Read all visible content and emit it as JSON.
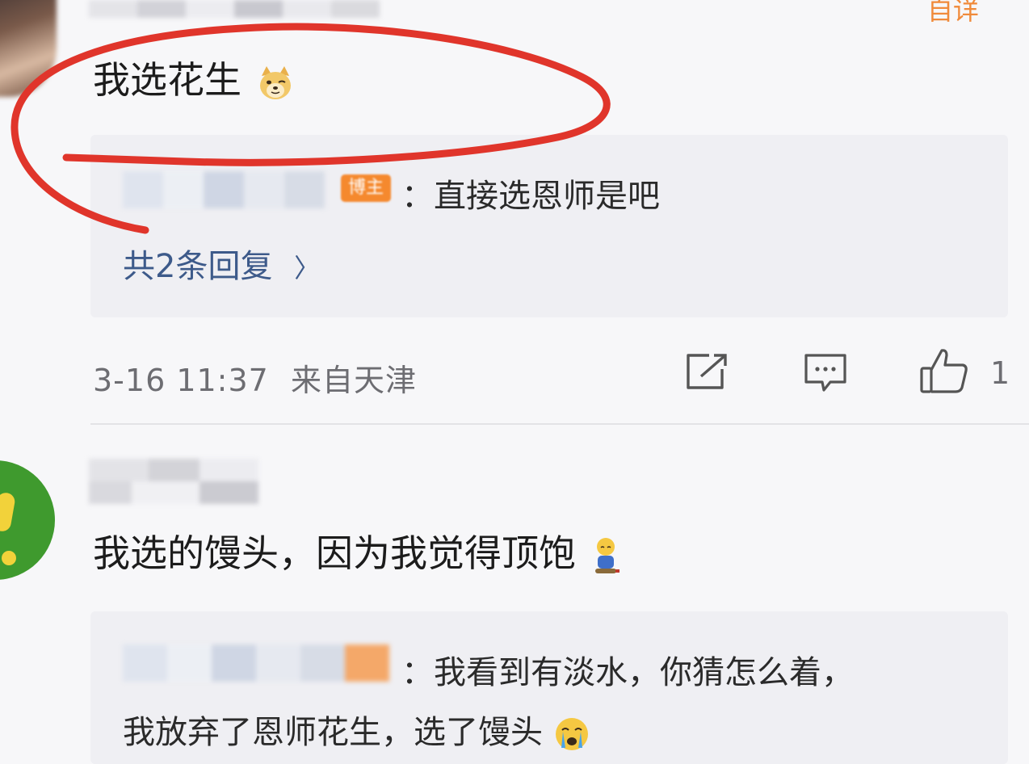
{
  "top_right_link": "自详",
  "comment1": {
    "text": "我选花生",
    "emoji": "doge-emoji",
    "reply": {
      "badge": "博主",
      "separator": "：",
      "text": "直接选恩师是吧"
    },
    "more_replies": "共2条回复",
    "more_chevron": "〉",
    "timestamp": "3-16 11:37",
    "location": "来自天津",
    "like_count": "1",
    "icons": [
      "share-icon",
      "comment-icon",
      "thumbs-up-icon"
    ]
  },
  "comment2": {
    "text": "我选的馒头，因为我觉得顶饱",
    "emoji": "sad-emoji",
    "reply": {
      "separator": "：",
      "text_line1": "我看到有淡水，你猜怎么着，",
      "text_line2": "我放弃了恩师花生，选了馒头",
      "emoji": "crying-emoji"
    }
  },
  "colors": {
    "annotation_red": "#e0352b",
    "link_blue": "#3d5a8a",
    "badge_orange": "#f5892e",
    "reply_bg": "#efeff3"
  }
}
